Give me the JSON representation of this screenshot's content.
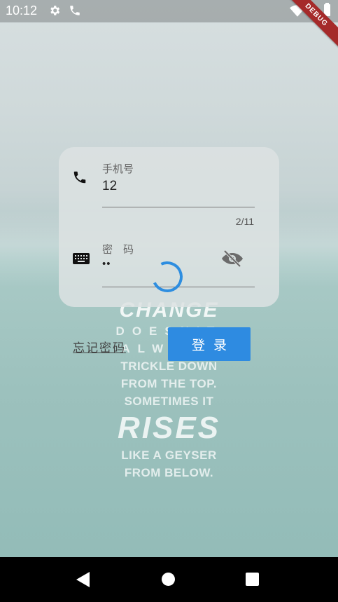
{
  "status_bar": {
    "time": "10:12",
    "icons": [
      "gear-icon",
      "phone-call-icon",
      "wifi-icon",
      "battery-icon"
    ],
    "debug_banner": "DEBUG"
  },
  "login_form": {
    "phone": {
      "label": "手机号",
      "value": "12",
      "counter": "2/11",
      "icon": "phone-icon"
    },
    "password": {
      "label": "密　码",
      "value": "••",
      "icon": "keyboard-icon",
      "toggle_icon": "eye-off-icon"
    },
    "loading": true
  },
  "actions": {
    "forgot_password": "忘记密码",
    "login": "登录"
  },
  "background_poster": {
    "lines": [
      "CHANGE",
      "DOESN'T",
      "ALWAYS",
      "TRICKLE DOWN",
      "FROM THE TOP.",
      "SOMETIMES IT",
      "RISES",
      "LIKE A GEYSER",
      "FROM BELOW."
    ]
  },
  "colors": {
    "accent": "#2e8be1",
    "debug_ribbon": "#a52a2a"
  }
}
